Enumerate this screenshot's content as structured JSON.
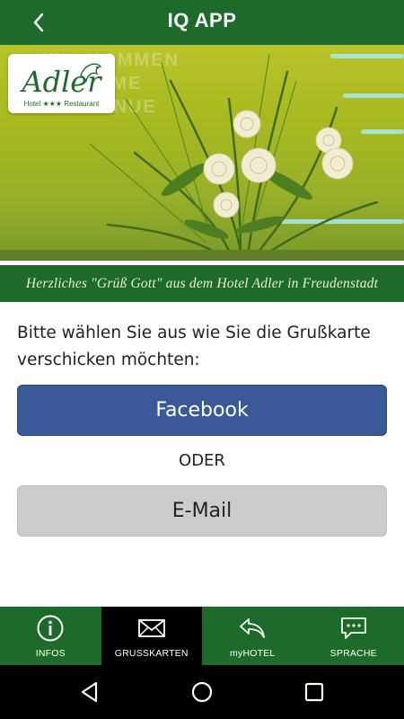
{
  "header": {
    "title": "IQ APP",
    "back_icon": "chevron-left-icon"
  },
  "banner": {
    "background_lines": [
      "WILLKOMMEN",
      "WELCOME",
      "BIENVENUE"
    ],
    "logo": {
      "name": "Adler",
      "subtitle": "Hotel ★★★ Restaurant"
    },
    "caption": "Herzliches \"Grüß Gott\" aus dem  Hotel Adler in Freudenstadt"
  },
  "content": {
    "prompt": "Bitte wählen Sie aus wie Sie die Grußkarte verschicken möchten:",
    "facebook_label": "Facebook",
    "or_label": "ODER",
    "email_label": "E-Mail"
  },
  "tabs": [
    {
      "label": "INFOS",
      "icon": "info-icon",
      "active": false
    },
    {
      "label": "GRUSSKARTEN",
      "icon": "envelope-icon",
      "active": true
    },
    {
      "label": "myHOTEL",
      "icon": "reply-arrow-icon",
      "active": false
    },
    {
      "label": "SPRACHE",
      "icon": "chat-bubble-icon",
      "active": false
    }
  ],
  "colors": {
    "brand_green": "#1d6b2b",
    "facebook_blue": "#3b5998",
    "email_gray": "#cccccc",
    "active_tab": "#000000"
  }
}
